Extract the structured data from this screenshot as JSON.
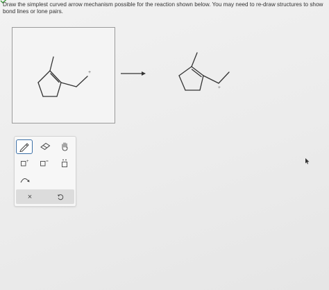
{
  "status": {
    "icon": "checkmark-icon",
    "color": "#3a9a3a"
  },
  "question": {
    "text": "Draw the simplest curved arrow mechanism possible for the reaction shown below. You may need to re-draw structures to show bond lines or lone pairs."
  },
  "reactant": {
    "charge_label": "+"
  },
  "product": {
    "charge_label": "+"
  },
  "toolbox": {
    "tools": [
      {
        "name": "pencil-tool",
        "icon": "pencil-icon",
        "selected": true
      },
      {
        "name": "eraser-tool",
        "icon": "eraser-icon",
        "selected": false
      },
      {
        "name": "hand-tool",
        "icon": "hand-icon",
        "selected": false
      },
      {
        "name": "positive-charge-tool",
        "icon": "positive-charge-icon",
        "selected": false
      },
      {
        "name": "negative-charge-tool",
        "icon": "negative-charge-icon",
        "selected": false
      },
      {
        "name": "lone-pair-tool",
        "icon": "lone-pair-icon",
        "selected": false
      },
      {
        "name": "curved-arrow-tool",
        "icon": "curved-arrow-icon",
        "selected": false
      }
    ],
    "actions": [
      {
        "name": "clear-button",
        "label": "×"
      },
      {
        "name": "undo-button",
        "icon": "undo-icon"
      }
    ]
  },
  "colors": {
    "selected_border": "#3a6ea5",
    "bond": "#333333"
  }
}
